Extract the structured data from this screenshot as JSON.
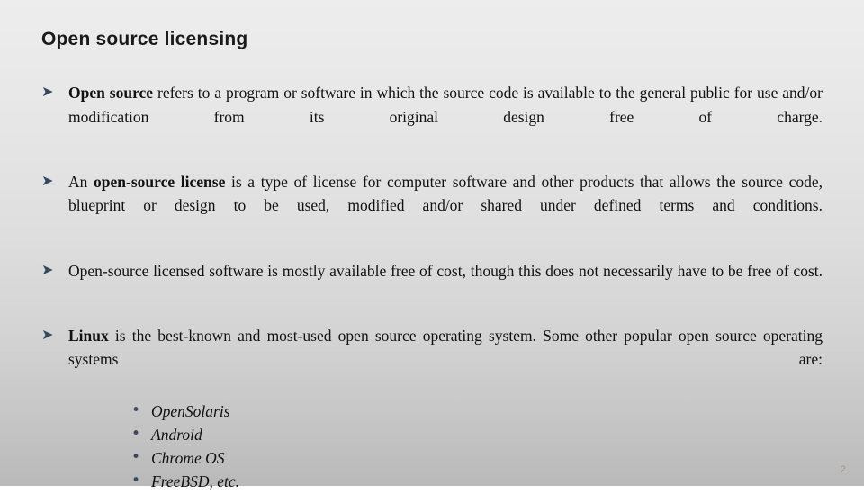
{
  "slide": {
    "title": "Open source licensing",
    "page_number": "2",
    "bullet_glyph": "➤",
    "sub_bullet_glyph": "•",
    "colors": {
      "bullet_arrow": "#33485f",
      "sub_bullet_dot": "#3a4a5e",
      "text": "#111111",
      "title": "#1a1a1a",
      "background_top": "#ededed",
      "background_bottom": "#b9b9b9"
    },
    "bullets": [
      {
        "segments": [
          {
            "text": "Open source",
            "bold": true
          },
          {
            "text": " refers to a program or software in which the source code is available to the general public for use and/or modification from its original design free of charge.",
            "bold": false
          }
        ]
      },
      {
        "segments": [
          {
            "text": "An ",
            "bold": false
          },
          {
            "text": "open-source license",
            "bold": true
          },
          {
            "text": " is a type of license for computer software and other products that allows the source code, blueprint or design to be used, modified and/or shared under defined terms and conditions.",
            "bold": false
          }
        ]
      },
      {
        "segments": [
          {
            "text": "Open-source licensed software is mostly available free of cost, though this does not necessarily have to be free of cost.",
            "bold": false
          }
        ]
      },
      {
        "segments": [
          {
            "text": "Linux",
            "bold": true
          },
          {
            "text": " is the best-known and most-used open source operating system. Some other popular open source operating systems are:",
            "bold": false
          }
        ],
        "sub_items": [
          "OpenSolaris",
          "Android",
          "Chrome OS",
          "FreeBSD, etc."
        ]
      }
    ]
  }
}
